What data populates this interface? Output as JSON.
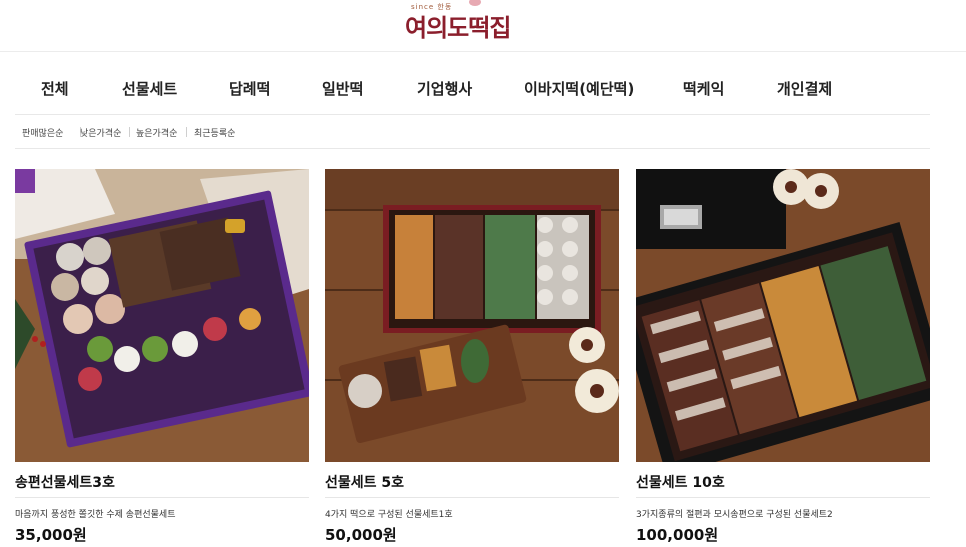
{
  "header": {
    "logo_small": "since 한동",
    "logo_text": "여의도떡집"
  },
  "nav": {
    "items": [
      {
        "label": "전체"
      },
      {
        "label": "선물세트"
      },
      {
        "label": "답례떡"
      },
      {
        "label": "일반떡"
      },
      {
        "label": "기업행사"
      },
      {
        "label": "이바지떡(예단떡)"
      },
      {
        "label": "떡케익"
      },
      {
        "label": "개인결제"
      }
    ]
  },
  "sort": {
    "items": [
      {
        "label": "판매많은순"
      },
      {
        "label": "낮은가격순"
      },
      {
        "label": "높은가격순"
      },
      {
        "label": "최근등록순"
      }
    ]
  },
  "products": [
    {
      "name": "송편선물세트3호",
      "desc": "마음까지 풍성한 쫄깃한 수제 송편선물세트",
      "price": "35,000원",
      "box_color": "#5a2a8c"
    },
    {
      "name": "선물세트 5호",
      "desc": "4가지 떡으로 구성된 선물세트1호",
      "price": "50,000원",
      "box_color": "#7a1d22"
    },
    {
      "name": "선물세트 10호",
      "desc": "3가지종류의 절편과 모시송편으로 구성된 선물세트2",
      "price": "100,000원",
      "box_color": "#1d1d1d"
    }
  ]
}
